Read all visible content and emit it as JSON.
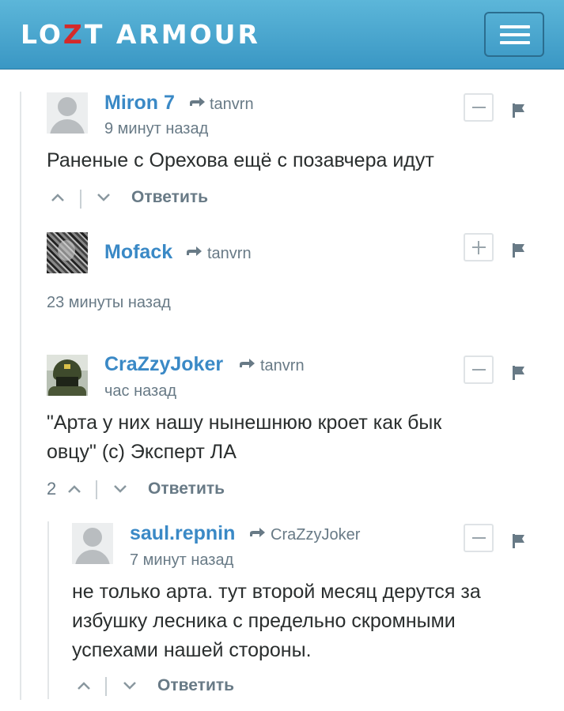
{
  "header": {
    "logo_part1": "LO",
    "logo_z": "Z",
    "logo_part2": "T ARMOUR",
    "menu_icon": "hamburger-icon",
    "colors": {
      "bar": "#4aa7d0",
      "logo_z": "#d42a2a"
    }
  },
  "comments": [
    {
      "author": "Miron 7",
      "reply_to": "tanvrn",
      "time": "9 минут назад",
      "text_lines": [
        "Раненые с Орехова ещё с позавчера идут"
      ],
      "votes": "",
      "toggle": "−",
      "reply_label": "Ответить",
      "avatar": "default-avatar"
    },
    {
      "author": "Mofack",
      "reply_to": "tanvrn",
      "time": "23 минуты назад",
      "text_lines": [],
      "votes": "",
      "toggle": "+",
      "reply_label": "",
      "avatar": "photo-avatar"
    },
    {
      "author": "CraZzyJoker",
      "reply_to": "tanvrn",
      "time": "час назад",
      "text_lines": [
        "\"Арта у них нашу нынешнюю кроет как бык",
        "овцу\" (с) Эксперт ЛА"
      ],
      "votes": "2",
      "toggle": "−",
      "reply_label": "Ответить",
      "avatar": "photo-avatar"
    },
    {
      "author": "saul.repnin",
      "reply_to": "CraZzyJoker",
      "time": "7 минут назад",
      "text_lines": [
        "не только арта. тут второй месяц дерутся за",
        "избушку лесника с предельно скромными",
        "успехами нашей стороны."
      ],
      "votes": "",
      "toggle": "−",
      "reply_label": "Ответить",
      "avatar": "default-avatar"
    }
  ]
}
